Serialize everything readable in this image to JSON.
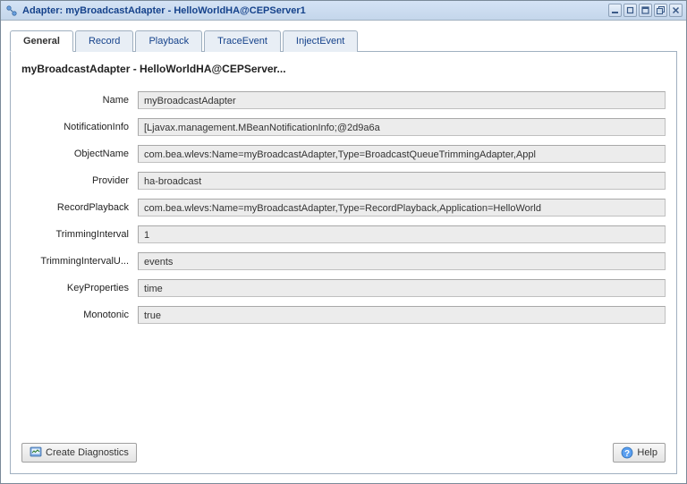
{
  "window": {
    "title": "Adapter: myBroadcastAdapter - HelloWorldHA@CEPServer1"
  },
  "tabs": [
    {
      "label": "General",
      "active": true
    },
    {
      "label": "Record",
      "active": false
    },
    {
      "label": "Playback",
      "active": false
    },
    {
      "label": "TraceEvent",
      "active": false
    },
    {
      "label": "InjectEvent",
      "active": false
    }
  ],
  "page": {
    "title": "myBroadcastAdapter - HelloWorldHA@CEPServer..."
  },
  "fields": {
    "name": {
      "label": "Name",
      "value": "myBroadcastAdapter"
    },
    "notificationInfo": {
      "label": "NotificationInfo",
      "value": "[Ljavax.management.MBeanNotificationInfo;@2d9a6a"
    },
    "objectName": {
      "label": "ObjectName",
      "value": "com.bea.wlevs:Name=myBroadcastAdapter,Type=BroadcastQueueTrimmingAdapter,Appl"
    },
    "provider": {
      "label": "Provider",
      "value": "ha-broadcast"
    },
    "recordPlayback": {
      "label": "RecordPlayback",
      "value": "com.bea.wlevs:Name=myBroadcastAdapter,Type=RecordPlayback,Application=HelloWorld"
    },
    "trimmingInterval": {
      "label": "TrimmingInterval",
      "value": "1"
    },
    "trimmingIntervalU": {
      "label": "TrimmingIntervalU...",
      "value": "events"
    },
    "keyProperties": {
      "label": "KeyProperties",
      "value": "time"
    },
    "monotonic": {
      "label": "Monotonic",
      "value": "true"
    }
  },
  "buttons": {
    "createDiagnostics": "Create Diagnostics",
    "help": "Help"
  }
}
